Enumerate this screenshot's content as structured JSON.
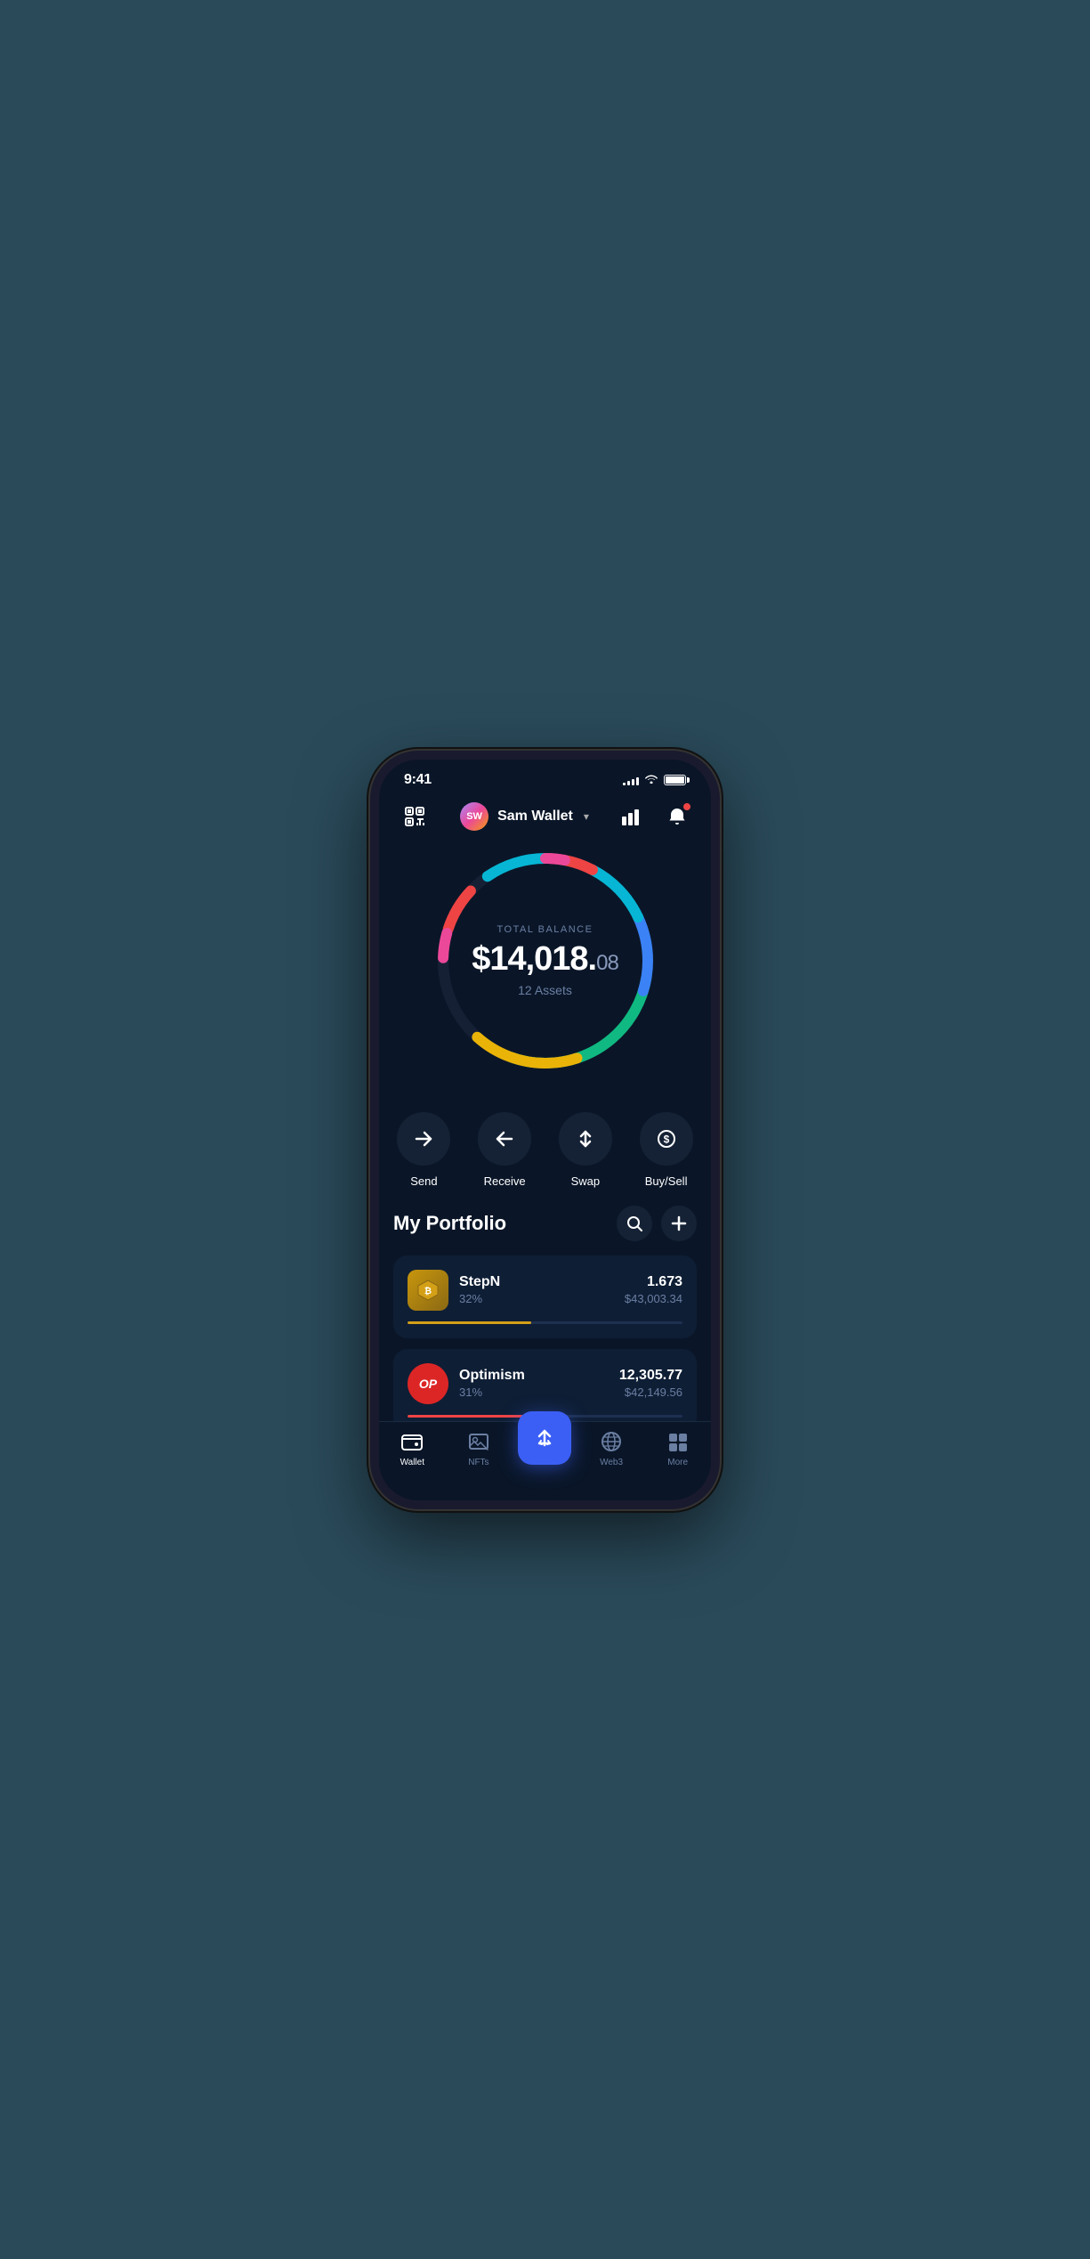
{
  "statusBar": {
    "time": "9:41",
    "signalBars": [
      3,
      5,
      7,
      9,
      11
    ],
    "battery": "full"
  },
  "header": {
    "scanLabel": "scan",
    "avatar": "SW",
    "walletName": "Sam Wallet",
    "chevron": "▾",
    "chartLabel": "chart",
    "notifLabel": "notification"
  },
  "balance": {
    "label": "TOTAL BALANCE",
    "whole": "$14,018.",
    "cents": "08",
    "assetsCount": "12 Assets"
  },
  "actions": [
    {
      "id": "send",
      "label": "Send",
      "icon": "→"
    },
    {
      "id": "receive",
      "label": "Receive",
      "icon": "←"
    },
    {
      "id": "swap",
      "label": "Swap",
      "icon": "⇅"
    },
    {
      "id": "buysell",
      "label": "Buy/Sell",
      "icon": "$"
    }
  ],
  "portfolio": {
    "title": "My Portfolio",
    "searchLabel": "search",
    "addLabel": "add"
  },
  "assets": [
    {
      "name": "StepN",
      "percent": "32%",
      "amount": "1.673",
      "usdValue": "$43,003.34",
      "progressColor": "#d4a017",
      "progressWidth": "45",
      "iconBg": "#b8860b",
      "iconColor": "#fff",
      "iconSymbol": "₿"
    },
    {
      "name": "Optimism",
      "percent": "31%",
      "amount": "12,305.77",
      "usdValue": "$42,149.56",
      "progressColor": "#ef4444",
      "progressWidth": "43",
      "iconBg": "#dc2626",
      "iconColor": "#fff",
      "iconSymbol": "OP"
    }
  ],
  "bottomNav": [
    {
      "id": "wallet",
      "label": "Wallet",
      "active": true
    },
    {
      "id": "nfts",
      "label": "NFTs",
      "active": false
    },
    {
      "id": "center",
      "label": "",
      "active": false
    },
    {
      "id": "web3",
      "label": "Web3",
      "active": false
    },
    {
      "id": "more",
      "label": "More",
      "active": false
    }
  ],
  "colors": {
    "background": "#0a1628",
    "cardBg": "#0e1e35",
    "accent": "#3b5ff5",
    "textPrimary": "#ffffff",
    "textSecondary": "#6b7fa3"
  }
}
